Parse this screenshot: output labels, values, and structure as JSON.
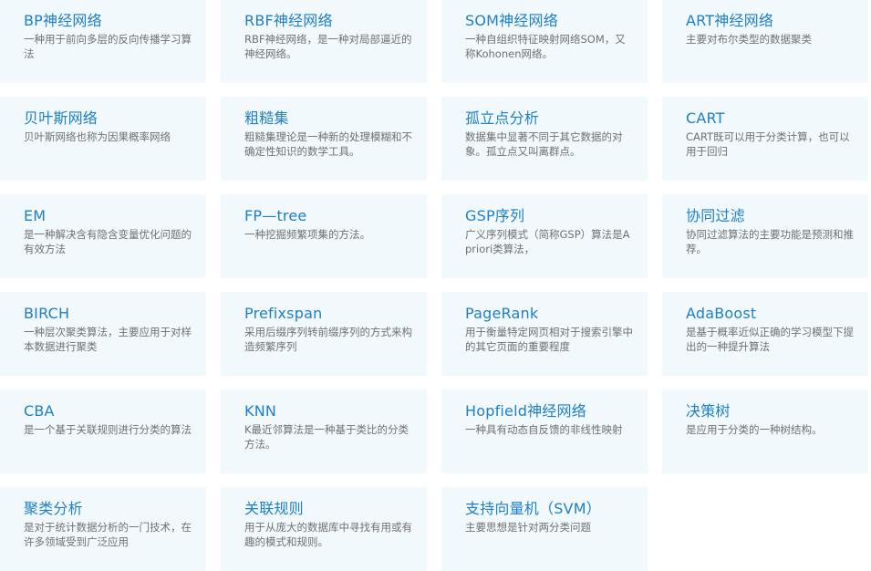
{
  "cards": [
    {
      "slug": "bp",
      "title": "BP神经网络",
      "desc": "一种用于前向多层的反向传播学习算法"
    },
    {
      "slug": "rbf",
      "title": "RBF神经网络",
      "desc": "RBF神经网络，是一种对局部逼近的神经网络。"
    },
    {
      "slug": "som",
      "title": "SOM神经网络",
      "desc": "一种自组织特征映射网络SOM，又称Kohonen网络。"
    },
    {
      "slug": "art",
      "title": "ART神经网络",
      "desc": "主要对布尔类型的数据聚类"
    },
    {
      "slug": "bayes",
      "title": "贝叶斯网络",
      "desc": "贝叶斯网络也称为因果概率网络"
    },
    {
      "slug": "rough-set",
      "title": "粗糙集",
      "desc": "粗糙集理论是一种新的处理模糊和不确定性知识的数学工具。"
    },
    {
      "slug": "outlier",
      "title": "孤立点分析",
      "desc": "数据集中显著不同于其它数据的对象。孤立点又叫离群点。"
    },
    {
      "slug": "cart",
      "title": "CART",
      "desc": "CART既可以用于分类计算，也可以用于回归"
    },
    {
      "slug": "em",
      "title": "EM",
      "desc": "是一种解决含有隐含变量优化问题的有效方法"
    },
    {
      "slug": "fp-tree",
      "title": "FP—tree",
      "desc": "一种挖掘频繁项集的方法。"
    },
    {
      "slug": "gsp",
      "title": "GSP序列",
      "desc": "广义序列模式（简称GSP）算法是Apriori类算法，"
    },
    {
      "slug": "collab-filter",
      "title": "协同过滤",
      "desc": "协同过滤算法的主要功能是预测和推荐。"
    },
    {
      "slug": "birch",
      "title": "BIRCH",
      "desc": "一种层次聚类算法，主要应用于对样本数据进行聚类"
    },
    {
      "slug": "prefixspan",
      "title": "Prefixspan",
      "desc": "采用后缀序列转前缀序列的方式来构造频繁序列"
    },
    {
      "slug": "pagerank",
      "title": "PageRank",
      "desc": "用于衡量特定网页相对于搜索引擎中的其它页面的重要程度"
    },
    {
      "slug": "adaboost",
      "title": "AdaBoost",
      "desc": "是基于概率近似正确的学习模型下提出的一种提升算法"
    },
    {
      "slug": "cba",
      "title": "CBA",
      "desc": "是一个基于关联规则进行分类的算法"
    },
    {
      "slug": "knn",
      "title": "KNN",
      "desc": "K最近邻算法是一种基于类比的分类方法。"
    },
    {
      "slug": "hopfield",
      "title": "Hopfield神经网络",
      "desc": "一种具有动态自反馈的非线性映射"
    },
    {
      "slug": "decision-tree",
      "title": "决策树",
      "desc": "是应用于分类的一种树结构。"
    },
    {
      "slug": "clustering",
      "title": "聚类分析",
      "desc": "是对于统计数据分析的一门技术，在许多领域受到广泛应用"
    },
    {
      "slug": "assoc-rules",
      "title": "关联规则",
      "desc": "用于从庞大的数据库中寻找有用或有趣的模式和规则。"
    },
    {
      "slug": "svm",
      "title": "支持向量机（SVM）",
      "desc": "主要思想是针对两分类问题"
    }
  ],
  "colors": {
    "card_bg": "#f1f9fd",
    "title": "#1f7ec8",
    "desc": "#707070"
  }
}
